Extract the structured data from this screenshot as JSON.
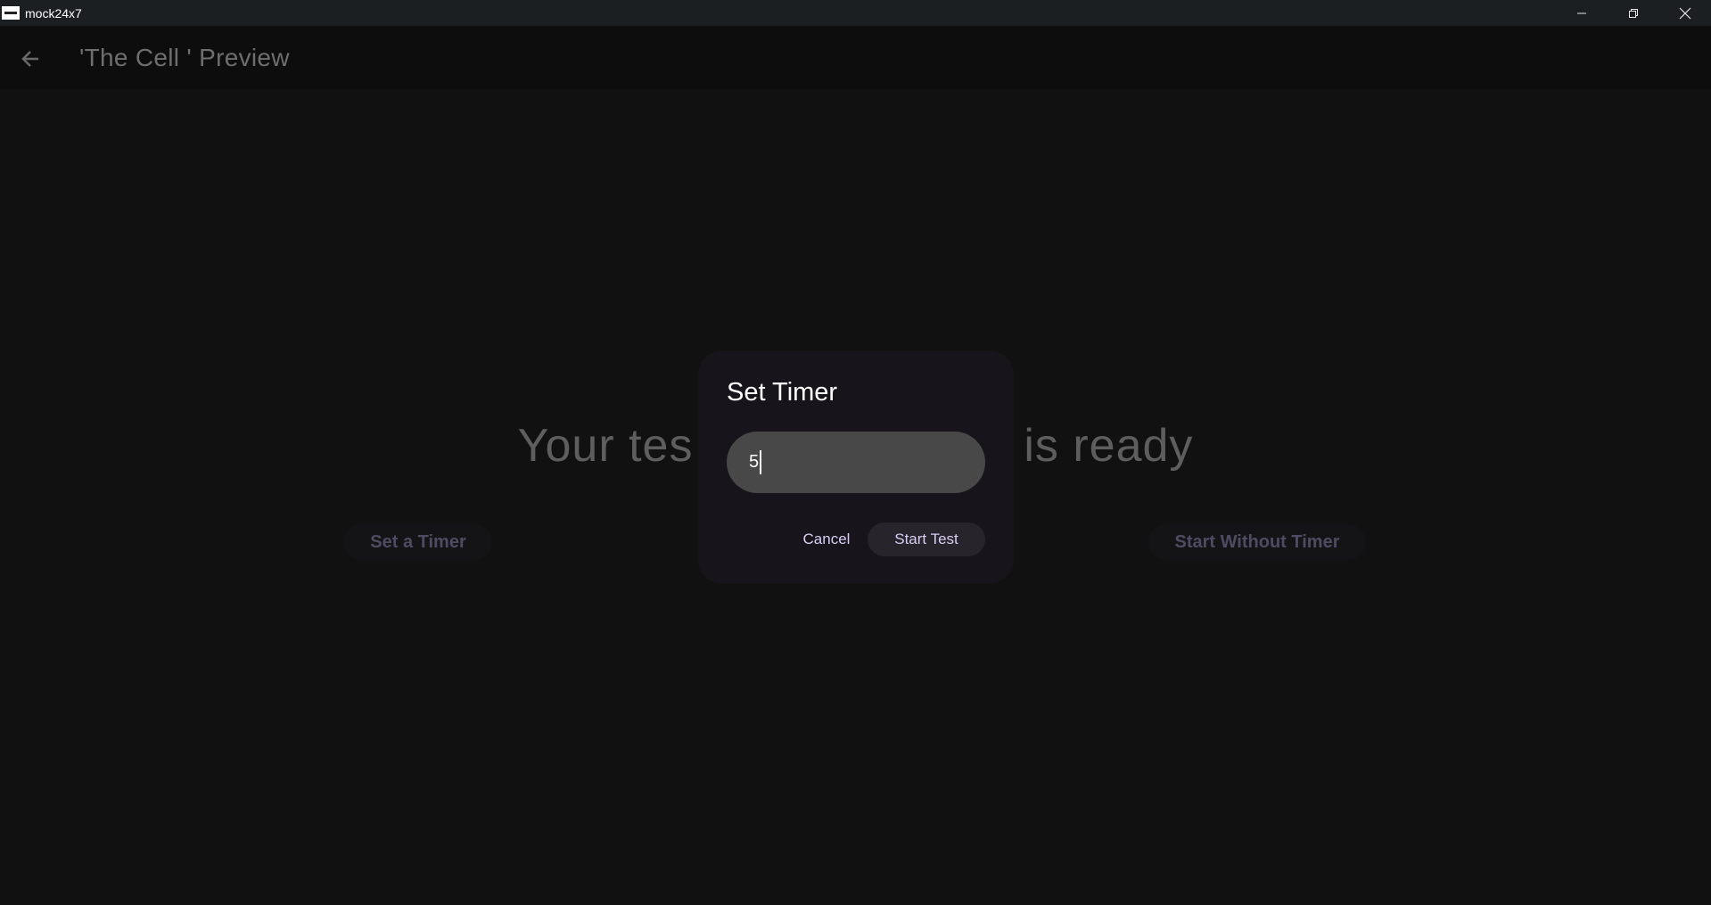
{
  "window": {
    "title": "mock24x7",
    "icons": [
      "app-icon",
      "minimize-icon",
      "restore-icon",
      "close-icon"
    ]
  },
  "appbar": {
    "back_icon": "arrow-left-icon",
    "title": "'The Cell ' Preview"
  },
  "main": {
    "ready_left": "Your tes",
    "ready_right": "is ready",
    "set_timer_label": "Set a Timer",
    "start_without_timer_label": "Start Without Timer"
  },
  "dialog": {
    "title": "Set Timer",
    "input_value": "5",
    "cancel_label": "Cancel",
    "start_label": "Start Test"
  },
  "colors": {
    "background": "#111111",
    "dialog_background": "#17151b",
    "accent_text": "#d7cdf5",
    "input_fill": "#484848"
  }
}
